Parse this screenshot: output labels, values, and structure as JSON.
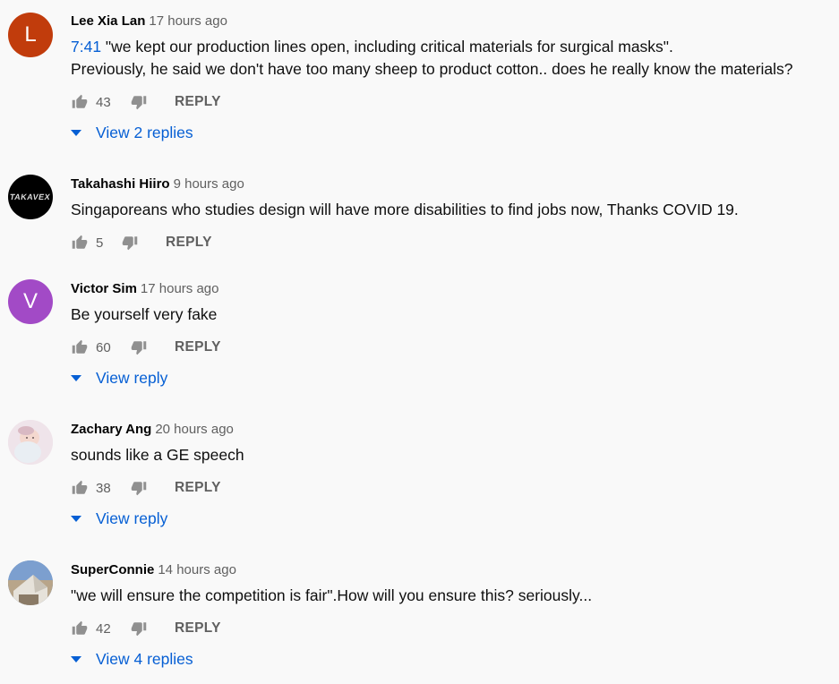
{
  "comments": [
    {
      "author": "Lee Xia Lan",
      "time": "17 hours ago",
      "timestamp_link": "7:41",
      "text": " \"we kept our production lines open, including critical materials for surgical masks\".\nPreviously, he said we don't have too many sheep to product cotton.. does he really know the materials?",
      "likes": "43",
      "reply_label": "REPLY",
      "view_replies": "View 2 replies",
      "avatar_letter": "L",
      "avatar_color": "#c13c0c"
    },
    {
      "author": "Takahashi Hiiro",
      "time": "9 hours ago",
      "text": "Singaporeans who studies design will have more disabilities to find jobs now, Thanks COVID 19.",
      "likes": "5",
      "reply_label": "REPLY",
      "avatar_text": "TAKAVEX",
      "avatar_color": "#000000"
    },
    {
      "author": "Victor Sim",
      "time": "17 hours ago",
      "text": "Be yourself very fake",
      "likes": "60",
      "reply_label": "REPLY",
      "view_replies": "View reply",
      "avatar_letter": "V",
      "avatar_color": "#a24ac6"
    },
    {
      "author": "Zachary Ang",
      "time": "20 hours ago",
      "text": "sounds like a GE speech",
      "likes": "38",
      "reply_label": "REPLY",
      "view_replies": "View reply"
    },
    {
      "author": "SuperConnie",
      "time": "14 hours ago",
      "text": "\"we will ensure the competition is fair\".How will you ensure this? seriously...",
      "likes": "42",
      "reply_label": "REPLY",
      "view_replies": "View 4 replies"
    }
  ],
  "icons": {
    "like": "thumb-up-icon",
    "dislike": "thumb-down-icon",
    "expand": "caret-down-icon"
  },
  "colors": {
    "link": "#065fd4",
    "meta": "#606060"
  }
}
